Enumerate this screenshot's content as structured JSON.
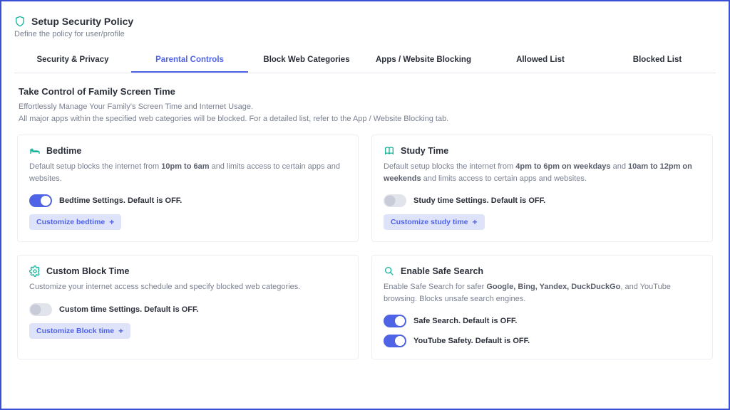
{
  "header": {
    "title": "Setup Security Policy",
    "subtitle": "Define the policy for user/profile"
  },
  "tabs": [
    {
      "label": "Security & Privacy"
    },
    {
      "label": "Parental Controls"
    },
    {
      "label": "Block Web Categories"
    },
    {
      "label": "Apps / Website Blocking"
    },
    {
      "label": "Allowed List"
    },
    {
      "label": "Blocked List"
    }
  ],
  "section": {
    "title": "Take Control of Family Screen Time",
    "desc1": "Effortlessly Manage Your Family's Screen Time and Internet Usage.",
    "desc2": "All major apps within the specified web categories will be blocked. For a detailed list, refer to the App / Website Blocking tab."
  },
  "bedtime": {
    "title": "Bedtime",
    "desc_pre": "Default setup blocks the internet from ",
    "desc_bold": "10pm to 6am",
    "desc_post": " and limits access to certain apps and websites.",
    "toggle_label": "Bedtime Settings. Default is OFF.",
    "button": "Customize bedtime"
  },
  "study": {
    "title": "Study Time",
    "desc_pre": "Default setup blocks the internet from ",
    "desc_bold1": "4pm to 6pm on weekdays",
    "desc_mid": " and ",
    "desc_bold2": "10am to 12pm on weekends",
    "desc_post": " and limits access to certain apps and websites.",
    "toggle_label": "Study time Settings. Default is OFF.",
    "button": "Customize study time"
  },
  "custom": {
    "title": "Custom Block Time",
    "desc": "Customize your internet access schedule and specify blocked web categories.",
    "toggle_label": "Custom time Settings. Default is OFF.",
    "button": "Customize Block time"
  },
  "safe": {
    "title": "Enable Safe Search",
    "desc_pre": "Enable Safe Search for safer ",
    "desc_bold": "Google, Bing, Yandex, DuckDuckGo",
    "desc_post": ", and YouTube browsing. Blocks unsafe search engines.",
    "toggle1_label": "Safe Search. Default is OFF.",
    "toggle2_label": "YouTube Safety. Default is OFF."
  }
}
